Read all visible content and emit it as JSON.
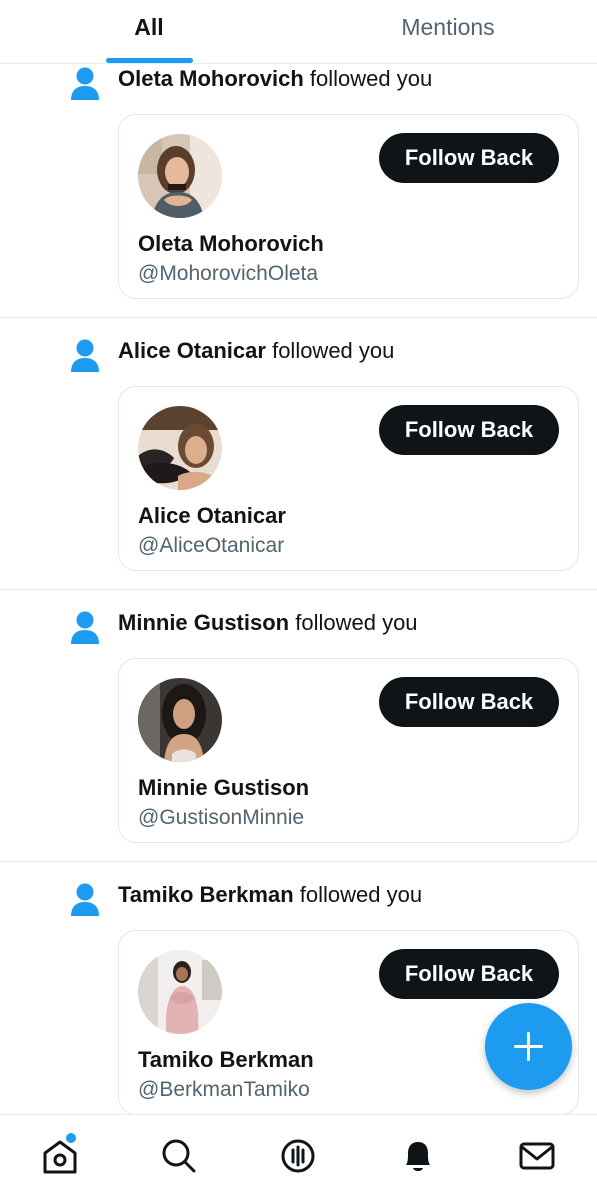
{
  "tabs": [
    {
      "label": "All",
      "active": true
    },
    {
      "label": "Mentions",
      "active": false
    }
  ],
  "followed_suffix": "followed you",
  "follow_button_label": "Follow Back",
  "notifications": [
    {
      "name": "Oleta Mohorovich",
      "handle": "@MohorovichOleta"
    },
    {
      "name": "Alice Otanicar",
      "handle": "@AliceOtanicar"
    },
    {
      "name": "Minnie Gustison",
      "handle": "@GustisonMinnie"
    },
    {
      "name": "Tamiko Berkman",
      "handle": "@BerkmanTamiko"
    }
  ],
  "colors": {
    "accent": "#1d9bf0",
    "button": "#0f1419",
    "muted_text": "#536471",
    "border": "#e1e8ed"
  },
  "icons": {
    "person": "person-icon",
    "fab": "compose-plus-icon",
    "nav": [
      "home-icon",
      "search-icon",
      "spaces-icon",
      "notifications-bell-icon",
      "messages-envelope-icon"
    ]
  }
}
